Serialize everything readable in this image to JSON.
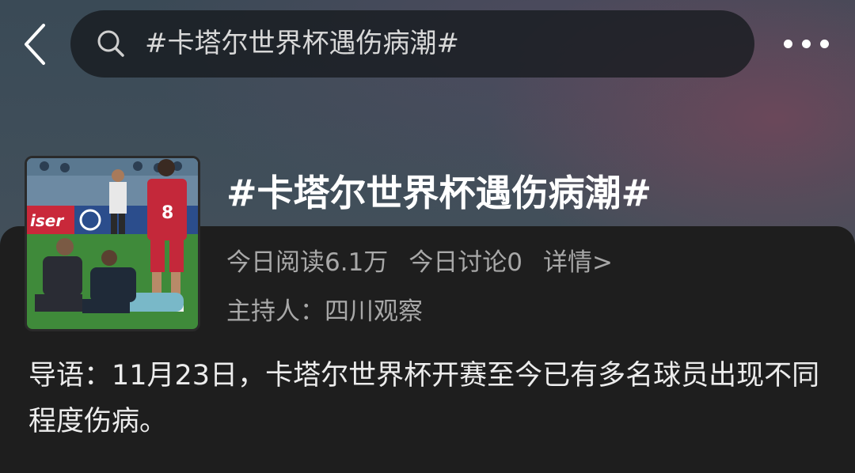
{
  "header": {
    "search_query": "#卡塔尔世界杯遇伤病潮#",
    "back_icon": "chevron-left-icon",
    "search_icon": "search-icon",
    "more_icon": "more-dots-icon"
  },
  "topic": {
    "title": "#卡塔尔世界杯遇伤病潮#",
    "today_reads": "今日阅读6.1万",
    "today_discussions": "今日讨论0",
    "details_link": "详情>",
    "host": "主持人：四川观察",
    "thumbnail": {
      "jersey_number": "8",
      "ad_text": "iser"
    }
  },
  "intro": {
    "text": "导语：11月23日，卡塔尔世界杯开赛至今已有多名球员出现不同程度伤病。"
  },
  "colors": {
    "sheet_bg": "#1e1e1e",
    "secondary_text": "#a8a8a8",
    "jersey_red": "#c4283a",
    "pitch_green": "#3f8a3a"
  }
}
